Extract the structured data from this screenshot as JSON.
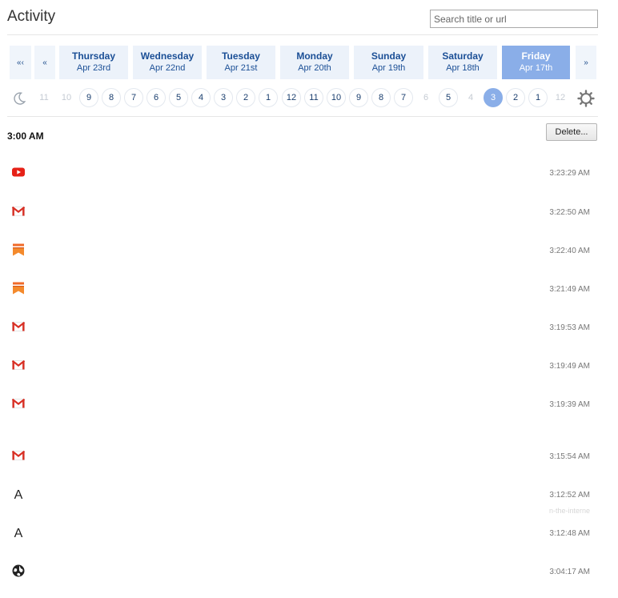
{
  "header": {
    "title": "Activity",
    "search_placeholder": "Search title or url"
  },
  "nav": {
    "first_label": "«‹",
    "prev_label": "«",
    "next_label": "»"
  },
  "days": [
    {
      "name": "Thursday",
      "date": "Apr 23rd",
      "active": false
    },
    {
      "name": "Wednesday",
      "date": "Apr 22nd",
      "active": false
    },
    {
      "name": "Tuesday",
      "date": "Apr 21st",
      "active": false
    },
    {
      "name": "Monday",
      "date": "Apr 20th",
      "active": false
    },
    {
      "name": "Sunday",
      "date": "Apr 19th",
      "active": false
    },
    {
      "name": "Saturday",
      "date": "Apr 18th",
      "active": false
    },
    {
      "name": "Friday",
      "date": "Apr 17th",
      "active": true
    }
  ],
  "hours": [
    {
      "label": "11",
      "state": "dim"
    },
    {
      "label": "10",
      "state": "dim"
    },
    {
      "label": "9",
      "state": "normal"
    },
    {
      "label": "8",
      "state": "normal"
    },
    {
      "label": "7",
      "state": "normal"
    },
    {
      "label": "6",
      "state": "normal"
    },
    {
      "label": "5",
      "state": "normal"
    },
    {
      "label": "4",
      "state": "normal"
    },
    {
      "label": "3",
      "state": "normal"
    },
    {
      "label": "2",
      "state": "normal"
    },
    {
      "label": "1",
      "state": "normal"
    },
    {
      "label": "12",
      "state": "normal"
    },
    {
      "label": "11",
      "state": "normal"
    },
    {
      "label": "10",
      "state": "normal"
    },
    {
      "label": "9",
      "state": "normal"
    },
    {
      "label": "8",
      "state": "normal"
    },
    {
      "label": "7",
      "state": "normal"
    },
    {
      "label": "6",
      "state": "dim"
    },
    {
      "label": "5",
      "state": "normal"
    },
    {
      "label": "4",
      "state": "dim"
    },
    {
      "label": "3",
      "state": "selected"
    },
    {
      "label": "2",
      "state": "normal"
    },
    {
      "label": "1",
      "state": "normal"
    },
    {
      "label": "12",
      "state": "dim"
    }
  ],
  "group": {
    "label": "3:00 AM",
    "delete_label": "Delete..."
  },
  "entries": [
    {
      "icon": "youtube-icon",
      "time": "3:23:29 AM"
    },
    {
      "icon": "gmail-icon",
      "time": "3:22:50 AM"
    },
    {
      "icon": "bookmark-icon",
      "time": "3:22:40 AM"
    },
    {
      "icon": "bookmark-icon",
      "time": "3:21:49 AM"
    },
    {
      "icon": "gmail-icon",
      "time": "3:19:53 AM"
    },
    {
      "icon": "gmail-icon",
      "time": "3:19:49 AM"
    },
    {
      "icon": "gmail-icon",
      "time": "3:19:39 AM"
    },
    {
      "icon": "gmail-icon",
      "time": "3:15:54 AM"
    },
    {
      "icon": "letter-a-icon",
      "time": "3:12:52 AM"
    },
    {
      "icon": "letter-a-icon",
      "time": "3:12:48 AM"
    },
    {
      "icon": "globe-icon",
      "time": "3:04:17 AM"
    }
  ],
  "ghost_text": "n-the-interne",
  "colors": {
    "accent": "#8aaee8",
    "day_bg": "#ecf2fa",
    "link": "#1b4f96"
  }
}
